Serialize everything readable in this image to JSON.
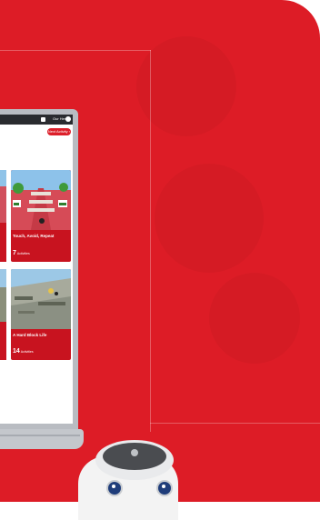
{
  "header": {
    "user_name": "Our Hero",
    "next_activity_label": "Next Activity"
  },
  "cards": [
    {
      "title": "Touch, Avoid, Repeat",
      "count": "7",
      "count_label": "Activities"
    },
    {
      "title": "A Hard Block Life",
      "count": "14",
      "count_label": "Activities"
    }
  ],
  "colors": {
    "brand_red": "#dd1c26",
    "card_red": "#c8131f",
    "topbar": "#2a2b2f"
  },
  "icons": {
    "logo": "square-logo-icon",
    "bell": "notification-icon",
    "next": "chevron-right-icon"
  }
}
